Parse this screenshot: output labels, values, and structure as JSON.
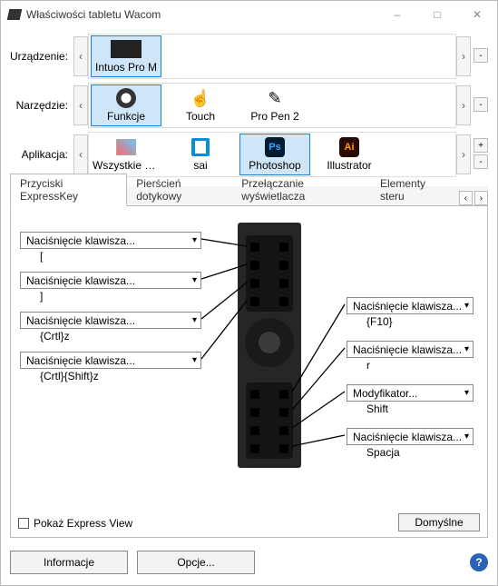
{
  "window": {
    "title": "Właściwości tabletu Wacom"
  },
  "rows": {
    "device": {
      "label": "Urządzenie:",
      "items": [
        "Intuos Pro M"
      ],
      "selected": 0
    },
    "tool": {
      "label": "Narzędzie:",
      "items": [
        "Funkcje",
        "Touch",
        "Pro Pen 2"
      ],
      "selected": 0
    },
    "app": {
      "label": "Aplikacja:",
      "items": [
        "Wszystkie poz...",
        "sai",
        "Photoshop",
        "Illustrator"
      ],
      "selected": 2
    }
  },
  "tabs": {
    "items": [
      "Przyciski ExpressKey",
      "Pierścień dotykowy",
      "Przełączanie wyświetlacza",
      "Elementy steru"
    ],
    "active": 0
  },
  "left_keys": [
    {
      "type": "Naciśnięcie klawisza...",
      "value": "["
    },
    {
      "type": "Naciśnięcie klawisza...",
      "value": "]"
    },
    {
      "type": "Naciśnięcie klawisza...",
      "value": "{Crtl}z"
    },
    {
      "type": "Naciśnięcie klawisza...",
      "value": "{Crtl}{Shift}z"
    }
  ],
  "right_keys": [
    {
      "type": "Naciśnięcie klawisza...",
      "value": "{F10}"
    },
    {
      "type": "Naciśnięcie klawisza...",
      "value": "r"
    },
    {
      "type": "Modyfikator...",
      "value": "Shift"
    },
    {
      "type": "Naciśnięcie klawisza...",
      "value": "Spacja"
    }
  ],
  "express_view": {
    "label": "Pokaż Express View",
    "checked": false
  },
  "default_btn": "Domyślne",
  "bottom": {
    "info": "Informacje",
    "options": "Opcje..."
  }
}
